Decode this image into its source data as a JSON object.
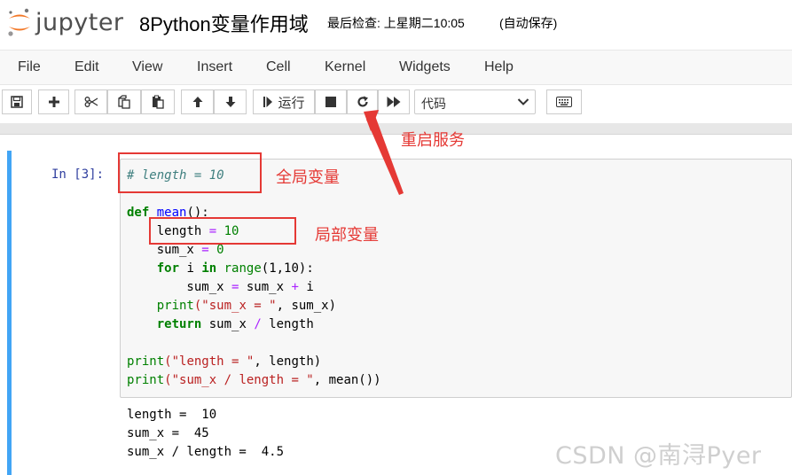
{
  "header": {
    "logo_text": "jupyter",
    "notebook_title": "8Python变量作用域",
    "checkpoint": "最后检查: 上星期二10:05",
    "autosave": "(自动保存)"
  },
  "menu": {
    "items": [
      "File",
      "Edit",
      "View",
      "Insert",
      "Cell",
      "Kernel",
      "Widgets",
      "Help"
    ]
  },
  "toolbar": {
    "run_label": "运行",
    "cell_type_value": "代码",
    "buttons": [
      "save-icon",
      "add-icon",
      "cut-icon",
      "copy-icon",
      "paste-icon",
      "move-up-icon",
      "move-down-icon",
      "run-icon",
      "stop-icon",
      "restart-icon",
      "fast-forward-icon",
      "keyboard-icon"
    ]
  },
  "cell": {
    "prompt": "In  [3]:",
    "code": {
      "line1": "# length = 10",
      "def_kw": "def",
      "func_name": "mean",
      "line2_rest": "():",
      "l3_a": "    length ",
      "l3_op": "=",
      "l3_num": " 10",
      "l4_a": "    sum_x ",
      "l4_op": "=",
      "l4_num": " 0",
      "l5_for": "for",
      "l5_i": " i ",
      "l5_in": "in",
      "l5_range": "range",
      "l5_rest": "(1,10):",
      "l6_a": "        sum_x ",
      "l6_op1": "=",
      "l6_b": " sum_x ",
      "l6_op2": "+",
      "l6_c": " i",
      "l7_print": "print",
      "l7_str": "(\"sum_x = \"",
      "l7_rest": ", sum_x)",
      "l8_ret": "return",
      "l8_a": " sum_x ",
      "l8_op": "/",
      "l8_b": " length",
      "l9_print": "print",
      "l9_str": "(\"length = \"",
      "l9_rest": ", length)",
      "l10_print": "print",
      "l10_str": "(\"sum_x / length = \"",
      "l10_rest": ", mean())"
    },
    "output": [
      "length =  10",
      "sum_x =  45",
      "sum_x / length =  4.5"
    ]
  },
  "annotations": {
    "restart_label": "重启服务",
    "global_label": "全局变量",
    "local_label": "局部变量"
  },
  "watermark": "CSDN @南浔Pyer",
  "colors": {
    "accent_red": "#e53935",
    "cell_border_blue": "#42a5f5",
    "prompt_blue": "#303f9f"
  }
}
